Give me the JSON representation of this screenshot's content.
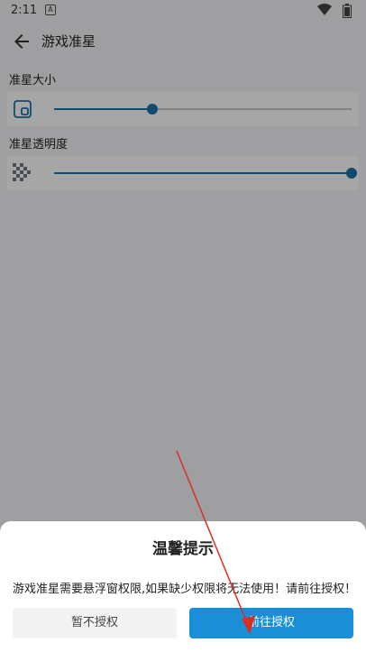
{
  "status_bar": {
    "time": "2:11",
    "note_glyph": "A"
  },
  "toolbar": {
    "title": "游戏准星"
  },
  "settings": {
    "size": {
      "label": "准星大小",
      "value_fraction": 0.33
    },
    "opacity": {
      "label": "准星透明度",
      "value_fraction": 1.0
    }
  },
  "dialog": {
    "title": "温馨提示",
    "message": "游戏准星需要悬浮窗权限,如果缺少权限将无法使用！请前往授权！",
    "cancel_label": "暂不授权",
    "confirm_label": "前往授权"
  },
  "colors": {
    "accent": "#1a73a9",
    "confirm": "#1a8fd8",
    "annotation_arrow": "#d93025"
  }
}
